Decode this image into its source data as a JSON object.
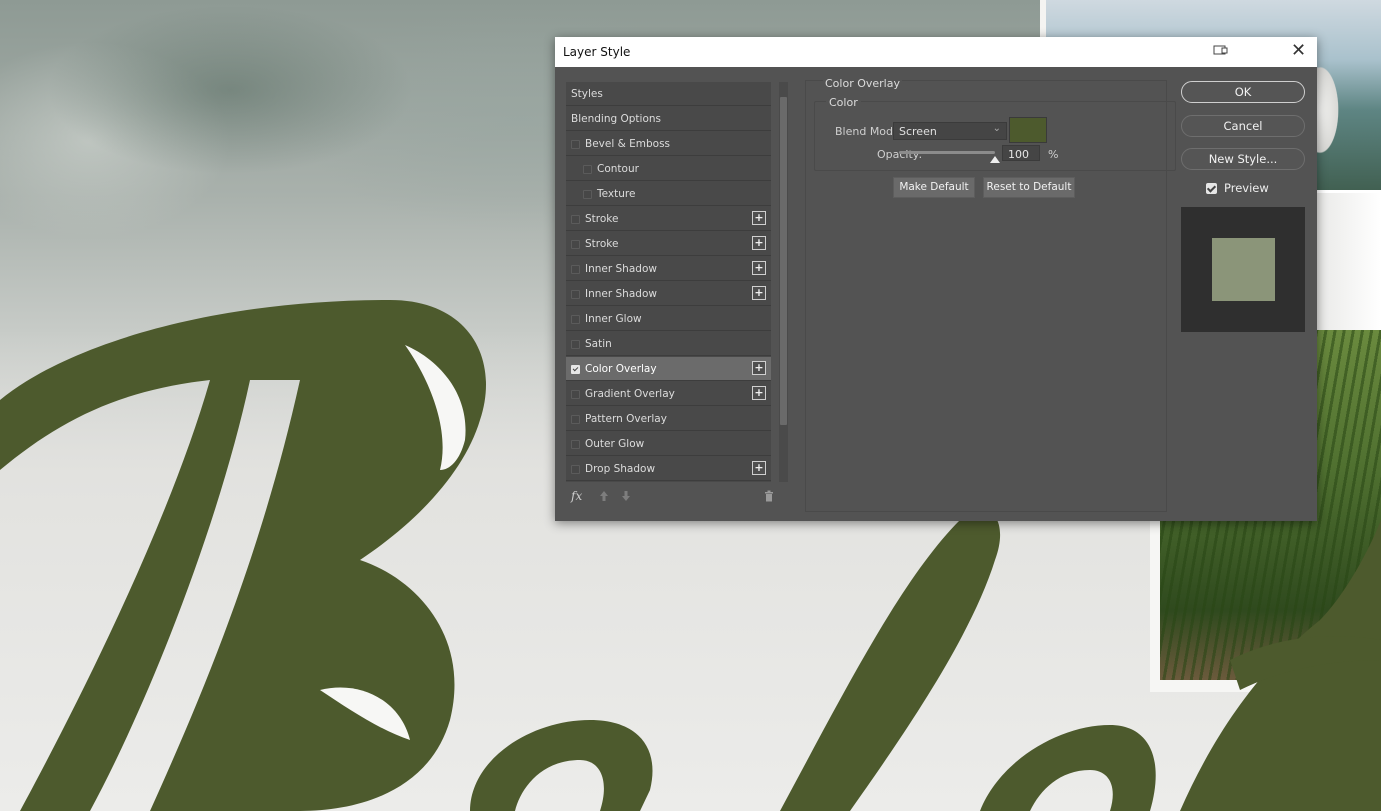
{
  "dialog": {
    "title": "Layer Style",
    "styles_list": [
      {
        "label": "Styles",
        "has_checkbox": false,
        "checked": false,
        "indent": 0,
        "has_plus": false,
        "selected": false
      },
      {
        "label": "Blending Options",
        "has_checkbox": false,
        "checked": false,
        "indent": 0,
        "has_plus": false,
        "selected": false
      },
      {
        "label": "Bevel & Emboss",
        "has_checkbox": true,
        "checked": false,
        "indent": 0,
        "has_plus": false,
        "selected": false
      },
      {
        "label": "Contour",
        "has_checkbox": true,
        "checked": false,
        "indent": 1,
        "has_plus": false,
        "selected": false
      },
      {
        "label": "Texture",
        "has_checkbox": true,
        "checked": false,
        "indent": 1,
        "has_plus": false,
        "selected": false
      },
      {
        "label": "Stroke",
        "has_checkbox": true,
        "checked": false,
        "indent": 0,
        "has_plus": true,
        "selected": false
      },
      {
        "label": "Stroke",
        "has_checkbox": true,
        "checked": false,
        "indent": 0,
        "has_plus": true,
        "selected": false
      },
      {
        "label": "Inner Shadow",
        "has_checkbox": true,
        "checked": false,
        "indent": 0,
        "has_plus": true,
        "selected": false
      },
      {
        "label": "Inner Shadow",
        "has_checkbox": true,
        "checked": false,
        "indent": 0,
        "has_plus": true,
        "selected": false
      },
      {
        "label": "Inner Glow",
        "has_checkbox": true,
        "checked": false,
        "indent": 0,
        "has_plus": false,
        "selected": false
      },
      {
        "label": "Satin",
        "has_checkbox": true,
        "checked": false,
        "indent": 0,
        "has_plus": false,
        "selected": false
      },
      {
        "label": "Color Overlay",
        "has_checkbox": true,
        "checked": true,
        "indent": 0,
        "has_plus": true,
        "selected": true
      },
      {
        "label": "Gradient Overlay",
        "has_checkbox": true,
        "checked": false,
        "indent": 0,
        "has_plus": true,
        "selected": false
      },
      {
        "label": "Pattern Overlay",
        "has_checkbox": true,
        "checked": false,
        "indent": 0,
        "has_plus": false,
        "selected": false
      },
      {
        "label": "Outer Glow",
        "has_checkbox": true,
        "checked": false,
        "indent": 0,
        "has_plus": false,
        "selected": false
      },
      {
        "label": "Drop Shadow",
        "has_checkbox": true,
        "checked": false,
        "indent": 0,
        "has_plus": true,
        "selected": false
      }
    ],
    "fx_label": "fx",
    "settings": {
      "group_title": "Color Overlay",
      "subgroup_title": "Color",
      "blend_mode_label": "Blend Mode:",
      "blend_mode_value": "Screen",
      "overlay_color": "#4d5a2d",
      "opacity_label": "Opacity:",
      "opacity_value": "100",
      "opacity_unit": "%",
      "opacity_fraction": 1.0,
      "make_default_label": "Make Default",
      "reset_default_label": "Reset to Default"
    },
    "buttons": {
      "ok": "OK",
      "cancel": "Cancel",
      "new_style": "New Style..."
    },
    "preview": {
      "label": "Preview",
      "checked": true,
      "swatch_color": "#8b9579"
    }
  },
  "canvas": {
    "lettering_color": "#4d5a2d",
    "lettering_text": "Balat"
  }
}
